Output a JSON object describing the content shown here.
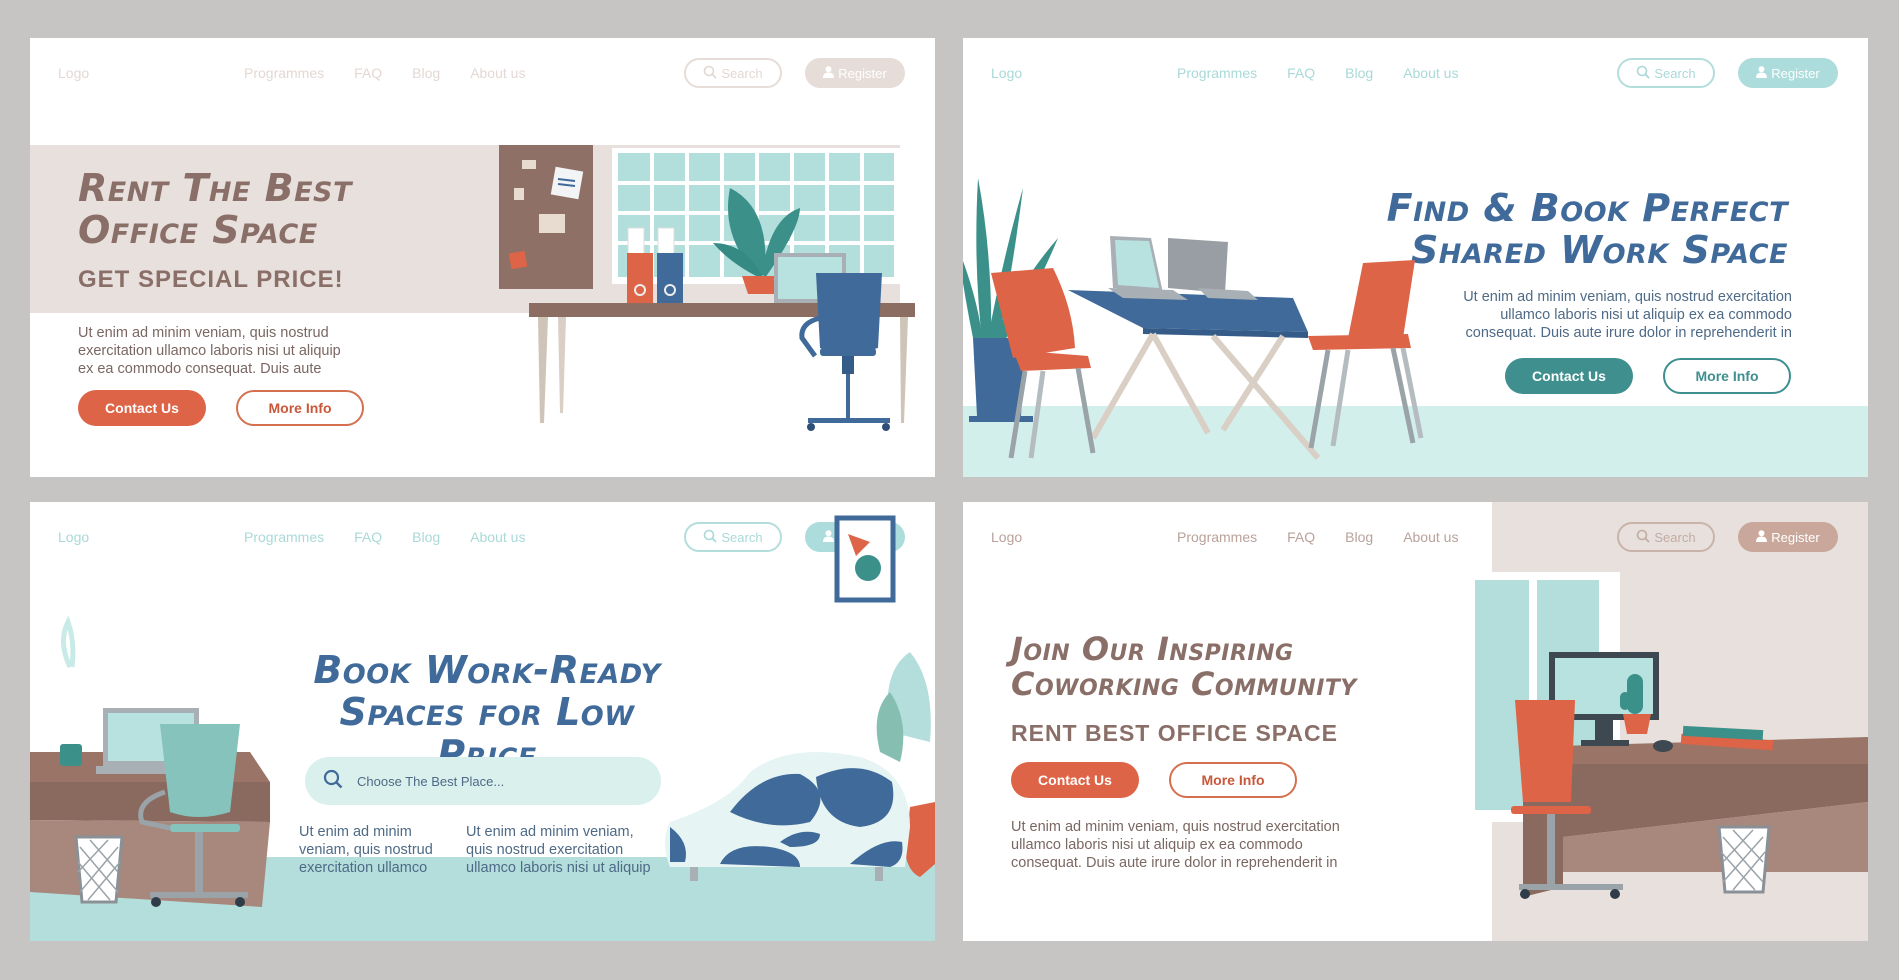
{
  "nav": {
    "logo": "Logo",
    "links": [
      "Programmes",
      "FAQ",
      "Blog",
      "About us"
    ],
    "search_label": "Search",
    "register_label": "Register",
    "search_icon": "search-icon",
    "user_icon": "user-icon"
  },
  "panels": [
    {
      "theme": "beige",
      "accent": "#dd6446",
      "title_color": "#8a6f68",
      "nav_color": "#e6ddd8",
      "title_lines": [
        "Rent The Best",
        "Office Space"
      ],
      "subtitle": "GET SPECIAL PRICE!",
      "body": [
        "Ut enim ad minim veniam, quis nostrud",
        "exercitation ullamco laboris nisi ut aliquip",
        "ex ea commodo consequat. Duis aute"
      ],
      "primary_button": "Contact Us",
      "secondary_button": "More Info"
    },
    {
      "theme": "teal",
      "accent": "#3f8f8f",
      "title_color": "#3f6a99",
      "nav_color": "#a9d9d8",
      "title_lines": [
        "Find & Book Perfect",
        "Shared Work Space"
      ],
      "body": [
        "Ut enim ad minim veniam, quis nostrud exercitation",
        "ullamco laboris nisi ut aliquip ex ea commodo",
        "consequat. Duis aute irure dolor in reprehenderit in"
      ],
      "primary_button": "Contact Us",
      "secondary_button": "More Info"
    },
    {
      "theme": "teal",
      "accent": "#3f6a99",
      "title_color": "#3f6a99",
      "nav_color": "#a9d9d8",
      "title_lines": [
        "Book Work-Ready",
        "Spaces for Low Price"
      ],
      "search_placeholder": "Choose The Best Place...",
      "body_col1": [
        "Ut enim ad minim",
        "veniam, quis nostrud",
        "exercitation ullamco"
      ],
      "body_col2": [
        "Ut enim ad minim veniam,",
        "quis nostrud exercitation",
        "ullamco laboris nisi ut aliquip"
      ]
    },
    {
      "theme": "beige",
      "accent": "#dd6446",
      "title_color": "#8a6f68",
      "nav_color": "#c9a89b",
      "title_lines": [
        "Join Our Inspiring",
        "Coworking Community"
      ],
      "subtitle": "RENT BEST OFFICE SPACE",
      "primary_button": "Contact Us",
      "secondary_button": "More Info",
      "body": [
        "Ut enim ad minim veniam, quis nostrud exercitation",
        "ullamco laboris nisi ut aliquip ex ea commodo",
        "consequat. Duis aute irure dolor in reprehenderit in"
      ]
    }
  ]
}
